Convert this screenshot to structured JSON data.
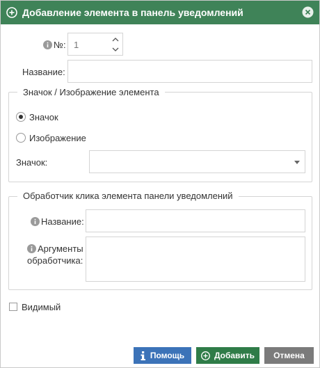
{
  "dialog": {
    "title": "Добавление элемента в панель уведомлений",
    "icons": {
      "title": "add-circle-icon",
      "close": "close-circle-icon"
    }
  },
  "form": {
    "number": {
      "label": "№:",
      "value": "1"
    },
    "name": {
      "label": "Название:",
      "value": ""
    }
  },
  "icon_group": {
    "legend": "Значок / Изображение элемента",
    "radio_icon_label": "Значок",
    "radio_image_label": "Изображение",
    "selected": "Значок",
    "icon_select_label": "Значок:",
    "icon_select_value": ""
  },
  "handler_group": {
    "legend": "Обработчик клика элемента панели уведомлений",
    "name_label": "Название:",
    "name_value": "",
    "args_label_line1": "Аргументы",
    "args_label_line2": "обработчика:",
    "args_value": ""
  },
  "visible": {
    "label": "Видимый",
    "checked": false
  },
  "buttons": {
    "help": "Помощь",
    "add": "Добавить",
    "cancel": "Отмена"
  },
  "colors": {
    "titlebar": "#3f8358",
    "help_button": "#3c73b8",
    "add_button": "#2f7c48",
    "cancel_button": "#7b7b7b"
  }
}
